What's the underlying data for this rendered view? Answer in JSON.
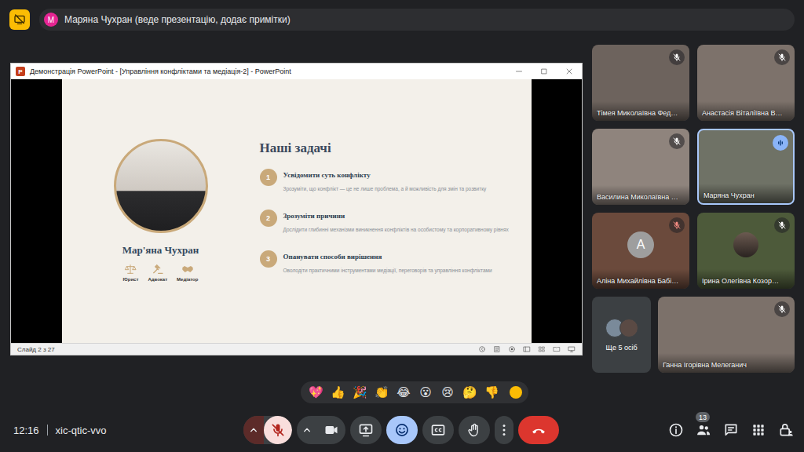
{
  "top_bar": {
    "presenter_initial": "М",
    "presenter_label": "Маряна Чухран (веде презентацію, додає примітки)"
  },
  "presentation": {
    "app_icon_letter": "P",
    "title": "Демонстрація PowerPoint - [Управління конфліктами та медіація-2] - PowerPoint",
    "slide": {
      "presenter_name": "Мар'яна Чухран",
      "roles": [
        {
          "label": "Юрист",
          "kind": "scales"
        },
        {
          "label": "Адвокат",
          "kind": "gavel"
        },
        {
          "label": "Медіатор",
          "kind": "handshake"
        }
      ],
      "heading": "Наші задачі",
      "tasks": [
        {
          "number": "1",
          "title": "Усвідомити суть конфлікту",
          "description": "Зрозуміти, що конфлікт — це не лише проблема, а й можливість для змін та розвитку"
        },
        {
          "number": "2",
          "title": "Зрозуміти причини",
          "description": "Дослідити глибинні механізми виникнення конфліктів на особистому та корпоративному рівнях"
        },
        {
          "number": "3",
          "title": "Опанувати способи вирішення",
          "description": "Оволодіти практичними інструментами медіації, переговорів та управління конфліктами"
        }
      ]
    },
    "status": "Слайд 2 з 27"
  },
  "participants": [
    {
      "name": "Тімея Миколаївна Фед…",
      "kind": "video",
      "muted": true,
      "speaking": false
    },
    {
      "name": "Анастасія Віталіївна В…",
      "kind": "video",
      "muted": true,
      "speaking": false
    },
    {
      "name": "Василина Миколаївна …",
      "kind": "video",
      "muted": true,
      "speaking": false
    },
    {
      "name": "Маряна Чухран",
      "kind": "video",
      "muted": false,
      "speaking": true
    },
    {
      "name": "Аліна Михайлівна Бабі…",
      "kind": "avatar",
      "initial": "А",
      "muted": true,
      "speaking": false
    },
    {
      "name": "Ірина Олегівна Козор…",
      "kind": "photo",
      "muted": true,
      "speaking": false
    },
    {
      "name": "Ганна Ігорівна Мелеганич",
      "kind": "video",
      "muted": true,
      "speaking": false
    }
  ],
  "more_people": "Ще 5 осіб",
  "reactions": [
    "💖",
    "👍",
    "🎉",
    "👏",
    "😂",
    "😮",
    "😢",
    "🤔",
    "👎"
  ],
  "meeting": {
    "time": "12:16",
    "code": "xic-qtic-vvo",
    "people_count": "13"
  },
  "controls": [
    {
      "kind": "mic",
      "on": false
    },
    {
      "kind": "camera",
      "on": true
    },
    {
      "kind": "present",
      "on": false
    },
    {
      "kind": "reactions",
      "on": true
    },
    {
      "kind": "captions",
      "on": false
    },
    {
      "kind": "hand",
      "on": false
    },
    {
      "kind": "more",
      "on": false
    },
    {
      "kind": "end",
      "on": false
    }
  ]
}
